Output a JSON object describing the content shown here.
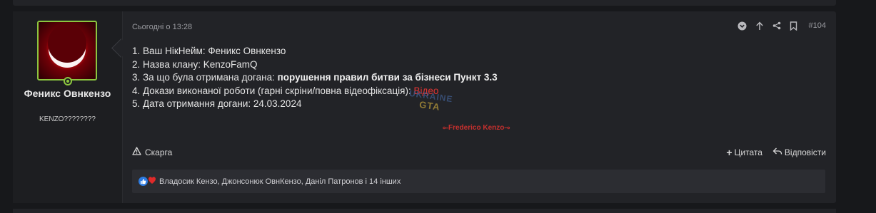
{
  "post": {
    "author": {
      "name": "Феникс Овнкензо",
      "title": "KENZO????????"
    },
    "date": "Сьогодні о 13:28",
    "number": "#104",
    "lines": [
      {
        "label": "1. Ваш НікНейм: ",
        "value": "Феникс Овнкензо"
      },
      {
        "label": "2. Назва клану: ",
        "value": "KenzoFamQ"
      },
      {
        "label": "3. За що була отримана догана: ",
        "value": "порушення правил битви за бізнеси Пункт 3.3"
      },
      {
        "label": "4. Докази виконаної роботи (гарні скріни/повна відеофіксація): ",
        "value": "Відео"
      },
      {
        "label": "5. Дата отримання догани: ",
        "value": "24.03.2024"
      }
    ],
    "watermark": {
      "line1": "UKRAINE",
      "line2": "GTA"
    },
    "signature": "Frederico Kenzo",
    "report_label": "Скарга",
    "quote_label": "Цитата",
    "reply_label": "Відповісти",
    "reactions_text": "Владосик Кензо, Джонсонюк ОвнКензо, Даніл Патронов і 14 інших"
  },
  "colors": {
    "online": "#8cc63f",
    "link": "#e03434",
    "like": "#2d7be0",
    "heart": "#e02a2a"
  },
  "icons": [
    "chevron-down-icon",
    "arrow-up-icon",
    "share-icon",
    "bookmark-icon",
    "warning-icon",
    "plus-icon",
    "reply-icon",
    "like-icon",
    "heart-icon"
  ]
}
